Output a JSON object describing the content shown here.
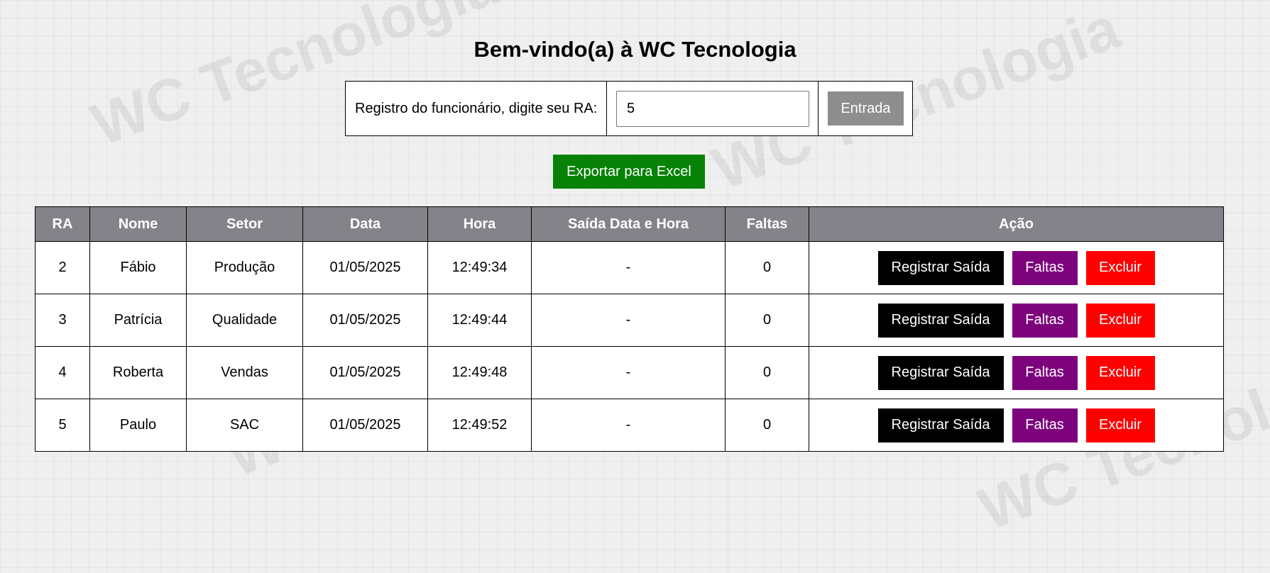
{
  "watermark": {
    "text": "WC Tecnologia"
  },
  "page": {
    "title": "Bem-vindo(a) à WC Tecnologia"
  },
  "entry_form": {
    "label": "Registro do funcionário, digite seu RA:",
    "ra_value": "5",
    "submit_label": "Entrada"
  },
  "export_label": "Exportar para Excel",
  "table": {
    "headers": [
      "RA",
      "Nome",
      "Setor",
      "Data",
      "Hora",
      "Saída Data e Hora",
      "Faltas",
      "Ação"
    ],
    "action_labels": {
      "register_exit": "Registrar Saída",
      "absences": "Faltas",
      "delete": "Excluir"
    },
    "rows": [
      {
        "ra": "2",
        "nome": "Fábio",
        "setor": "Produção",
        "data": "01/05/2025",
        "hora": "12:49:34",
        "saida": "-",
        "faltas": "0"
      },
      {
        "ra": "3",
        "nome": "Patrícia",
        "setor": "Qualidade",
        "data": "01/05/2025",
        "hora": "12:49:44",
        "saida": "-",
        "faltas": "0"
      },
      {
        "ra": "4",
        "nome": "Roberta",
        "setor": "Vendas",
        "data": "01/05/2025",
        "hora": "12:49:48",
        "saida": "-",
        "faltas": "0"
      },
      {
        "ra": "5",
        "nome": "Paulo",
        "setor": "SAC",
        "data": "01/05/2025",
        "hora": "12:49:52",
        "saida": "-",
        "faltas": "0"
      }
    ]
  },
  "colors": {
    "entrada_button": "#8e8e8e",
    "export_button": "#078207",
    "header_bg": "#85838a",
    "register_exit_button": "#000000",
    "absences_button": "#7d037d",
    "delete_button": "#ff0000"
  }
}
